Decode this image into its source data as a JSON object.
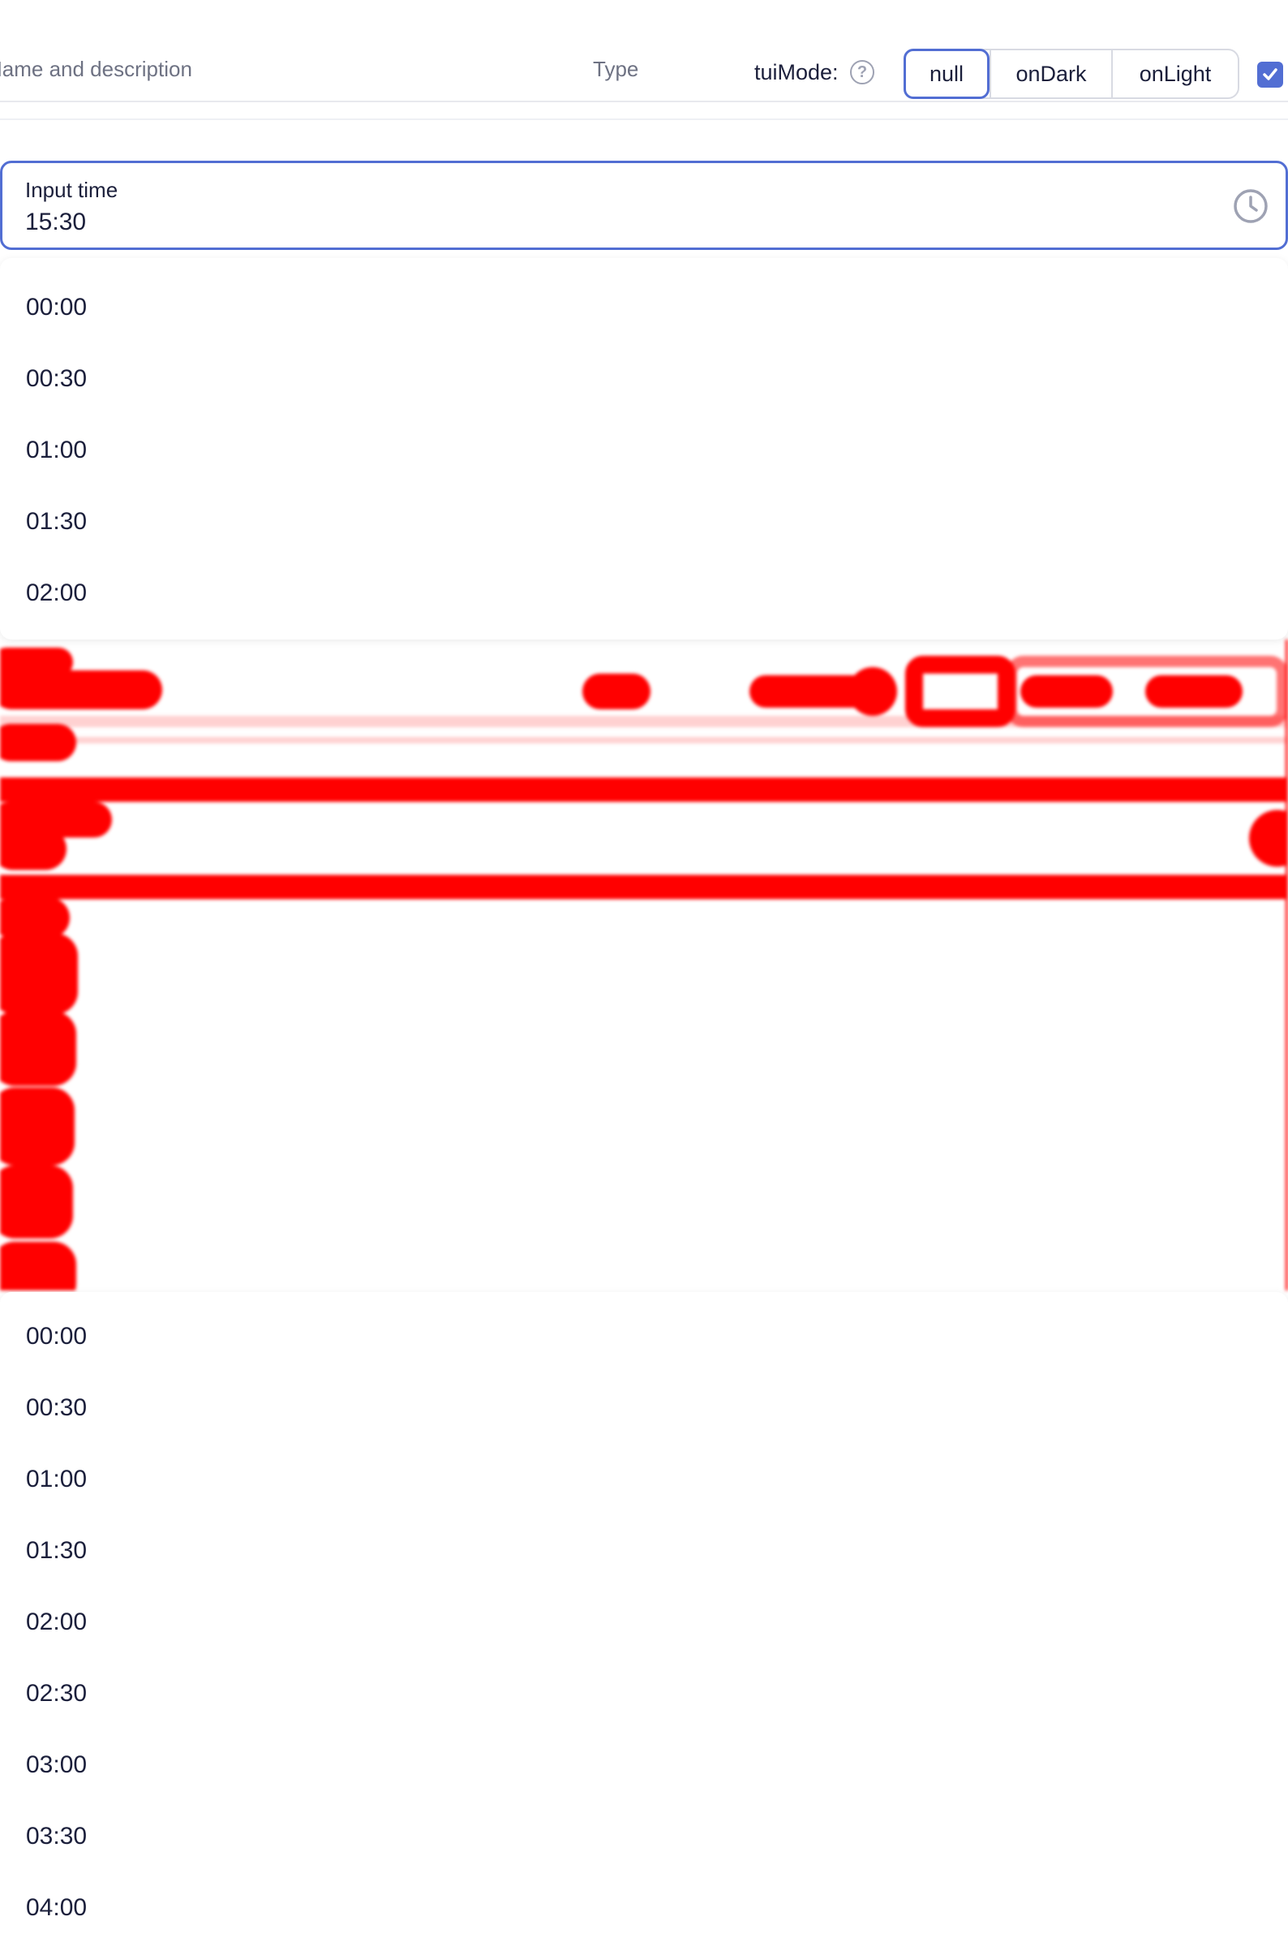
{
  "header": {
    "col_name": "Name and description",
    "col_type": "Type",
    "mode_label": "tuiMode:",
    "help_glyph": "?",
    "modes": [
      "null",
      "onDark",
      "onLight"
    ],
    "active_mode": "null",
    "checkbox_checked": true,
    "accent_color": "#526ed3"
  },
  "input": {
    "label": "Input time",
    "value": "15:30",
    "icon": "clock-icon"
  },
  "dropdown_top": {
    "items": [
      "00:00",
      "00:30",
      "01:00",
      "01:30",
      "02:00"
    ]
  },
  "dropdown_bottom": {
    "items": [
      "00:00",
      "00:30",
      "01:00",
      "01:30",
      "02:00",
      "02:30",
      "03:00",
      "03:30",
      "04:00"
    ]
  }
}
